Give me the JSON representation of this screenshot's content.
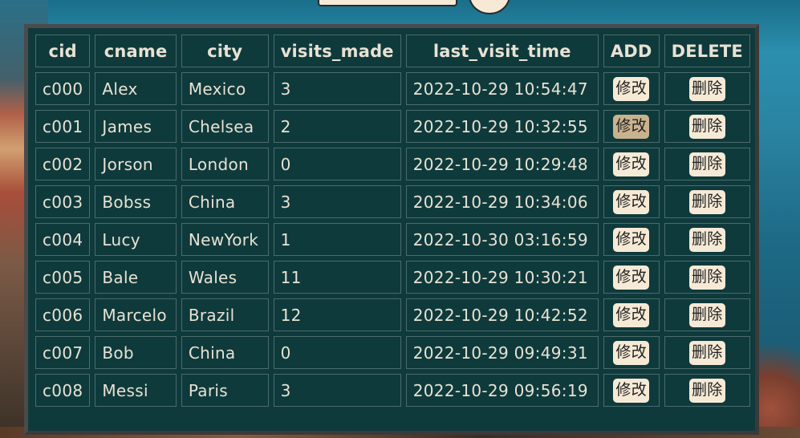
{
  "table": {
    "headers": {
      "cid": "cid",
      "cname": "cname",
      "city": "city",
      "visits_made": "visits_made",
      "last_visit_time": "last_visit_time",
      "add": "ADD",
      "delete": "DELETE"
    },
    "edit_label": "修改",
    "delete_label": "删除",
    "rows": [
      {
        "cid": "c000",
        "cname": "Alex",
        "city": "Mexico",
        "visits": "3",
        "time": "2022-10-29 10:54:47"
      },
      {
        "cid": "c001",
        "cname": "James",
        "city": "Chelsea",
        "visits": "2",
        "time": "2022-10-29 10:32:55"
      },
      {
        "cid": "c002",
        "cname": "Jorson",
        "city": "London",
        "visits": "0",
        "time": "2022-10-29 10:29:48"
      },
      {
        "cid": "c003",
        "cname": "Bobss",
        "city": "China",
        "visits": "3",
        "time": "2022-10-29 10:34:06"
      },
      {
        "cid": "c004",
        "cname": "Lucy",
        "city": "NewYork",
        "visits": "1",
        "time": "2022-10-30 03:16:59"
      },
      {
        "cid": "c005",
        "cname": "Bale",
        "city": "Wales",
        "visits": "11",
        "time": "2022-10-29 10:30:21"
      },
      {
        "cid": "c006",
        "cname": "Marcelo",
        "city": "Brazil",
        "visits": "12",
        "time": "2022-10-29 10:42:52"
      },
      {
        "cid": "c007",
        "cname": "Bob",
        "city": "China",
        "visits": "0",
        "time": "2022-10-29 09:49:31"
      },
      {
        "cid": "c008",
        "cname": "Messi",
        "city": "Paris",
        "visits": "3",
        "time": "2022-10-29 09:56:19"
      }
    ],
    "active_edit_row": 1
  },
  "colors": {
    "table_bg": "#0f3a3c",
    "text": "#e8e2d3",
    "button_bg": "#f6ead6",
    "button_active_bg": "#c9b28e",
    "frame": "#4b4b4b"
  }
}
